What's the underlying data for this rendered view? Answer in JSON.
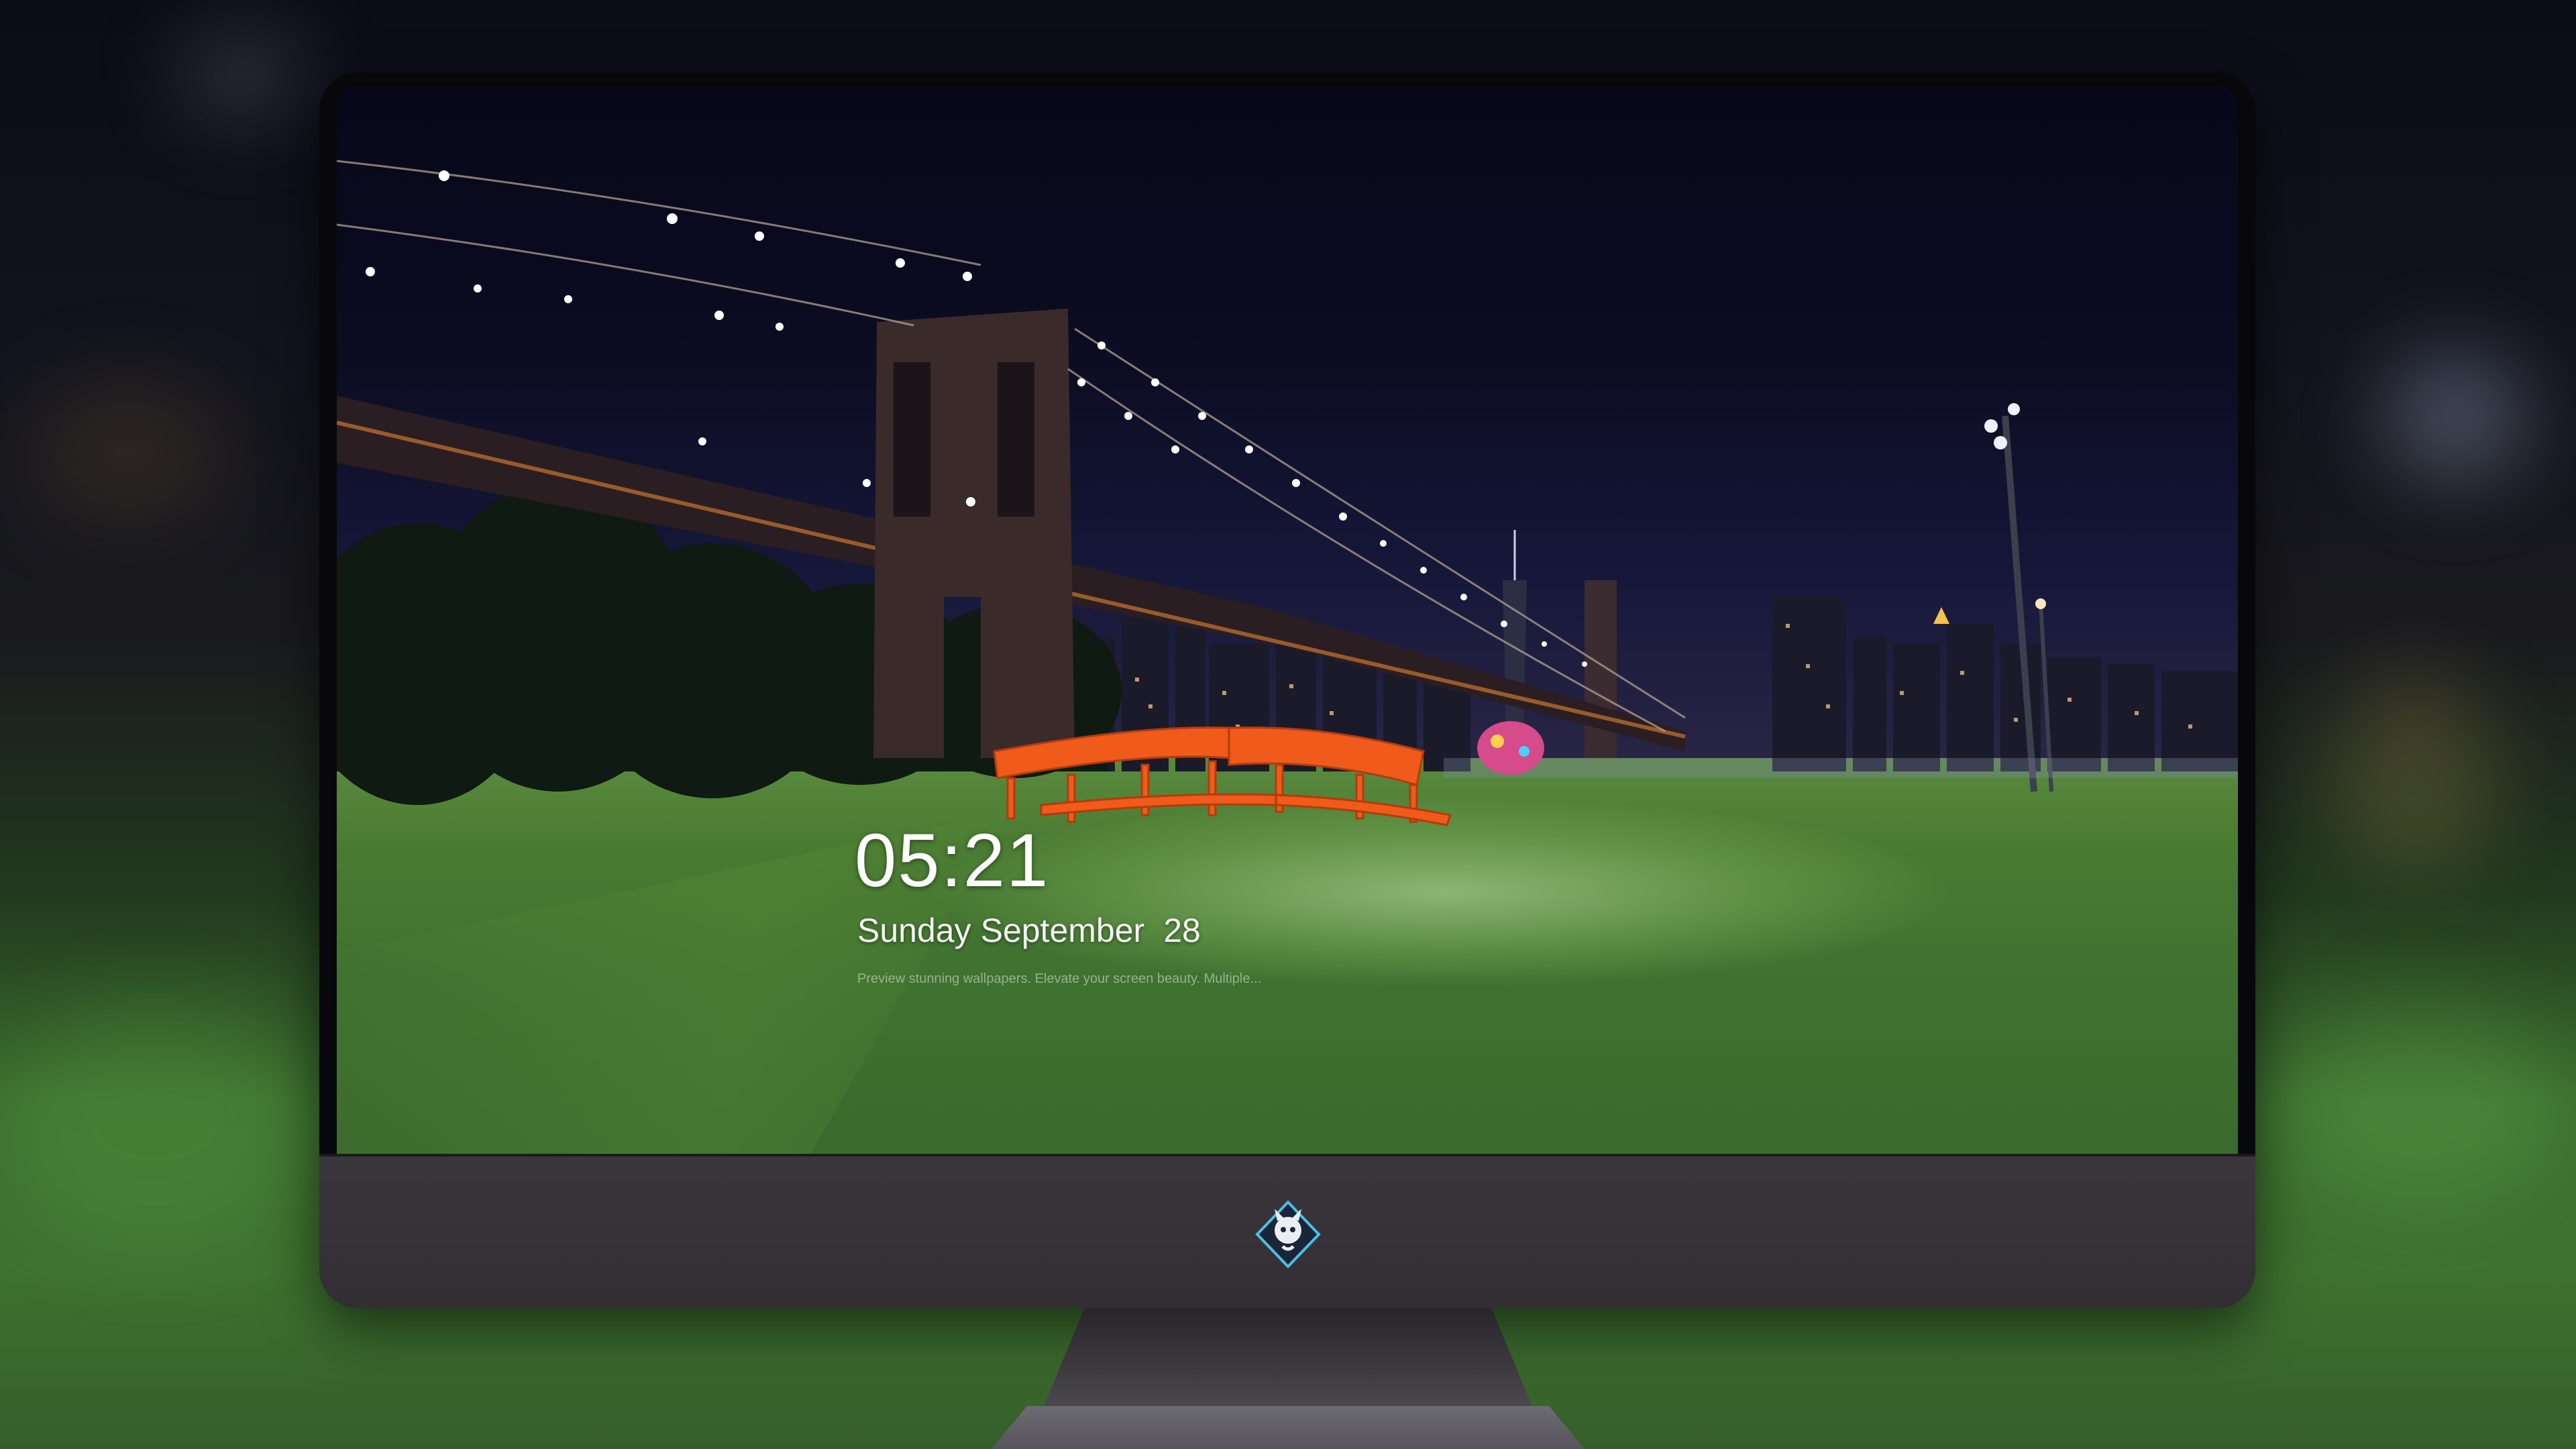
{
  "lock_screen": {
    "time": "05:21",
    "weekday": "Sunday",
    "month": "September",
    "day": "28",
    "tagline": "Preview stunning wallpapers. Elevate your screen beauty. Multiple..."
  },
  "dock": {
    "items": [
      {
        "name": "messages-icon",
        "color": "#2ed158"
      },
      {
        "name": "weather-icon",
        "color": "#2f8ff0"
      },
      {
        "name": "clock-icon",
        "color": "#1c1c1e"
      },
      {
        "name": "preview-icon",
        "color": "#f2c94c"
      },
      {
        "name": "clips-icon",
        "color": "#36aef2"
      },
      {
        "name": "notes-icon",
        "color": "#ffd23f"
      },
      {
        "name": "photos-icon",
        "color": "#6bc46d"
      },
      {
        "name": "itunes-icon",
        "color": "#e04ce0"
      },
      {
        "name": "app-store-icon",
        "color": "#1e88f5"
      },
      {
        "name": "camera-icon",
        "color": "#5a5a60"
      }
    ]
  },
  "colors": {
    "bench": "#f05a1a",
    "sky": "#0b0b1c",
    "grass": "#4a7b32",
    "monitor_chin": "#3a353b"
  }
}
